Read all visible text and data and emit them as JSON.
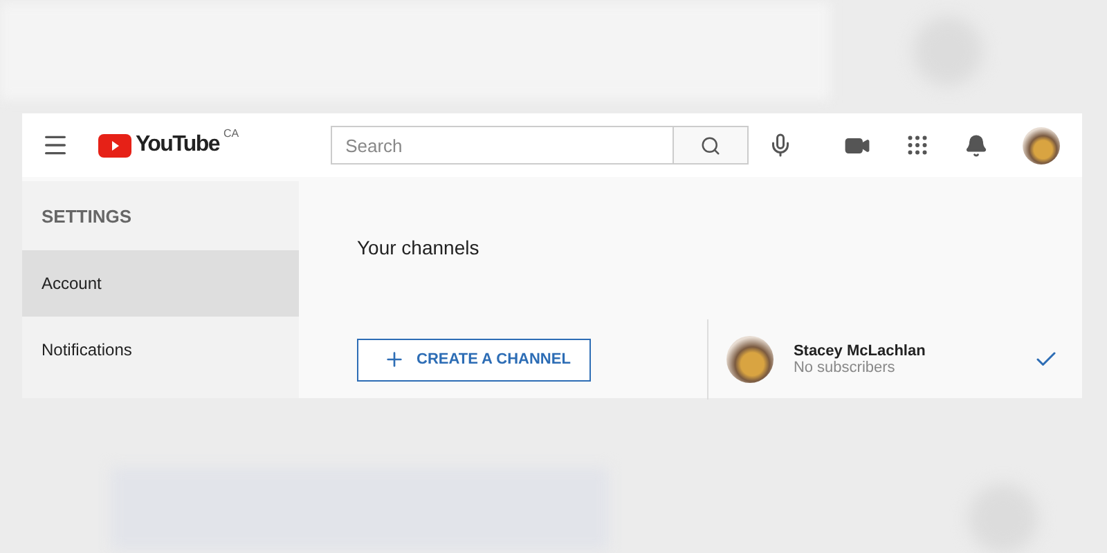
{
  "header": {
    "logo": "YouTube",
    "region": "CA",
    "search": {
      "placeholder": "Search"
    }
  },
  "sidebar": {
    "title": "SETTINGS",
    "items": [
      {
        "label": "Account",
        "selected": true
      },
      {
        "label": "Notifications",
        "selected": false
      }
    ]
  },
  "main": {
    "heading": "Your channels",
    "create_button": "CREATE A CHANNEL",
    "channels": [
      {
        "name": "Stacey McLachlan",
        "subscribers": "No subscribers",
        "selected": true
      }
    ]
  }
}
